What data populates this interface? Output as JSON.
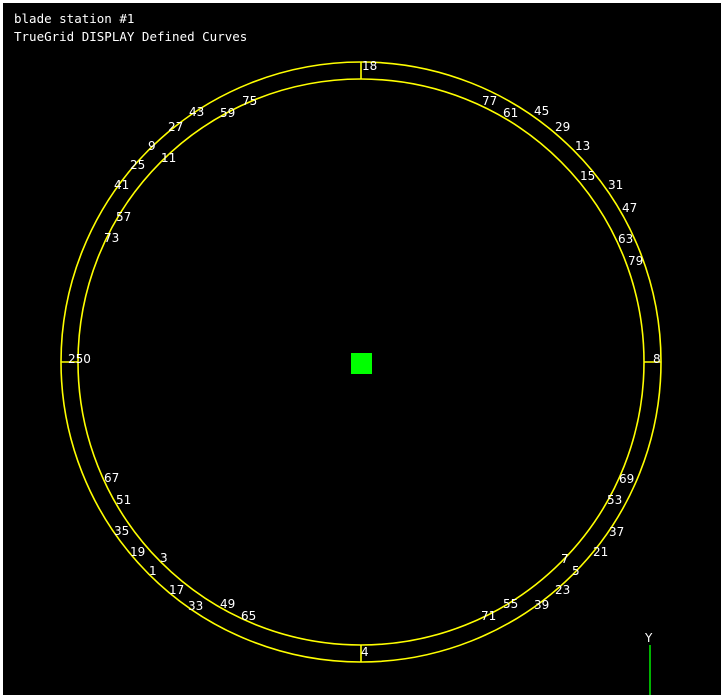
{
  "header": {
    "title": "blade station #1",
    "subtitle": "TrueGrid DISPLAY Defined Curves"
  },
  "colors": {
    "background": "#000000",
    "curve": "#ffff00",
    "label": "#ffffff",
    "marker": "#00ff00",
    "axis": "#00ff00"
  },
  "axis": {
    "y_label": "Y"
  },
  "node_labels": [
    "18",
    "8",
    "4",
    "250",
    "75",
    "59",
    "43",
    "27",
    "9",
    "11",
    "25",
    "41",
    "57",
    "73",
    "77",
    "61",
    "45",
    "29",
    "13",
    "15",
    "31",
    "47",
    "63",
    "79",
    "67",
    "51",
    "35",
    "19",
    "3",
    "1",
    "17",
    "33",
    "49",
    "65",
    "69",
    "53",
    "37",
    "21",
    "7",
    "5",
    "23",
    "39",
    "55",
    "71"
  ]
}
